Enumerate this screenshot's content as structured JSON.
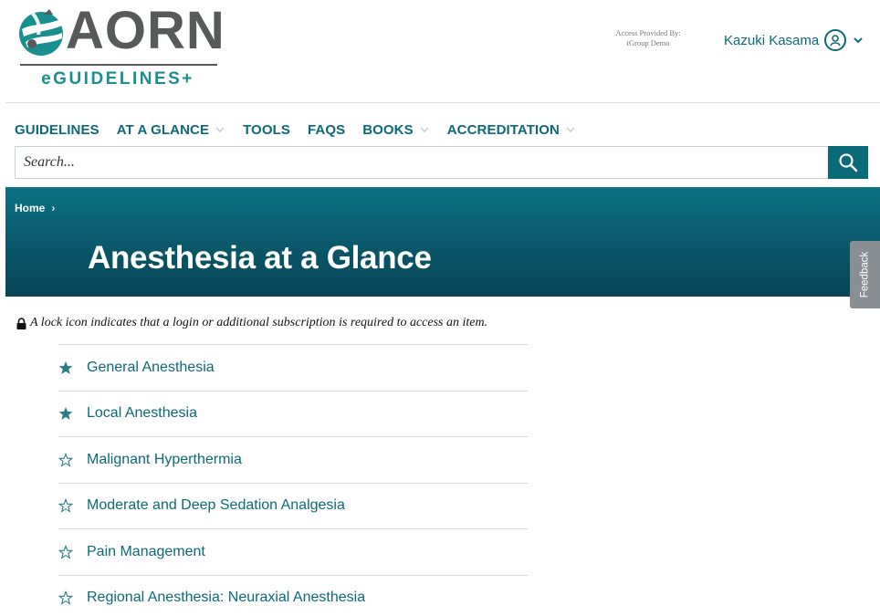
{
  "brand": {
    "logo_text": "AORN",
    "logo_subtext": "eGUIDELINES+",
    "brand_color": "#1a8f8f",
    "logo_gray": "#58595b"
  },
  "access": {
    "line1": "Access Provided By:",
    "line2": "iGroup Demo"
  },
  "user": {
    "name": "Kazuki Kasama",
    "icon": "user-icon"
  },
  "nav": {
    "items": [
      {
        "label": "GUIDELINES",
        "dropdown": false
      },
      {
        "label": "AT A GLANCE",
        "dropdown": true
      },
      {
        "label": "TOOLS",
        "dropdown": false
      },
      {
        "label": "FAQS",
        "dropdown": false
      },
      {
        "label": "BOOKS",
        "dropdown": true
      },
      {
        "label": "ACCREDITATION",
        "dropdown": true
      }
    ]
  },
  "search": {
    "placeholder": "Search...",
    "value": ""
  },
  "banner": {
    "breadcrumb": "Home",
    "title": "Anesthesia at a Glance",
    "color": "#0b6a78"
  },
  "feedback": {
    "label": "Feedback"
  },
  "notice": {
    "text": "A lock icon indicates that a login or additional subscription is required to access an item."
  },
  "list": {
    "items": [
      {
        "label": "General Anesthesia",
        "starred": true
      },
      {
        "label": "Local Anesthesia",
        "starred": true
      },
      {
        "label": "Malignant Hyperthermia",
        "starred": false
      },
      {
        "label": "Moderate and Deep Sedation Analgesia",
        "starred": false
      },
      {
        "label": "Pain Management",
        "starred": false
      },
      {
        "label": "Regional Anesthesia: Neuraxial Anesthesia",
        "starred": false
      }
    ]
  }
}
